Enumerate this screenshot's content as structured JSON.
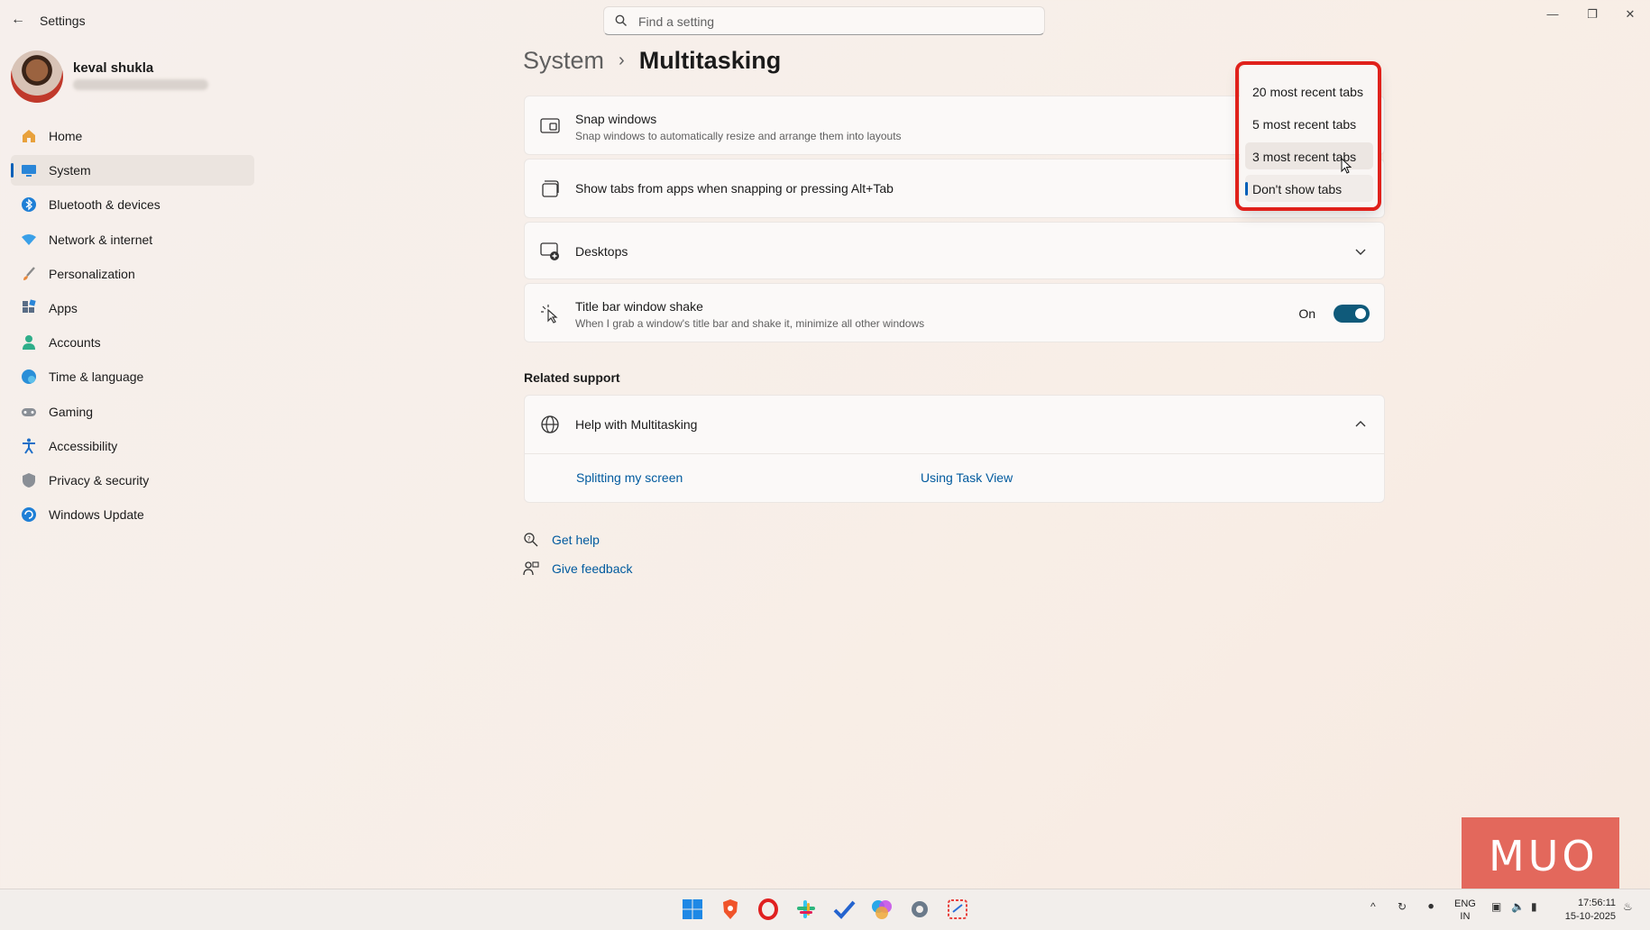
{
  "app": {
    "title": "Settings"
  },
  "search": {
    "placeholder": "Find a setting"
  },
  "user": {
    "name": "keval shukla"
  },
  "sidebar": {
    "items": [
      {
        "label": "Home",
        "icon": "home-icon"
      },
      {
        "label": "System",
        "icon": "system-icon",
        "active": true
      },
      {
        "label": "Bluetooth & devices",
        "icon": "bluetooth-icon"
      },
      {
        "label": "Network & internet",
        "icon": "network-icon"
      },
      {
        "label": "Personalization",
        "icon": "brush-icon"
      },
      {
        "label": "Apps",
        "icon": "apps-icon"
      },
      {
        "label": "Accounts",
        "icon": "accounts-icon"
      },
      {
        "label": "Time & language",
        "icon": "globe-clock-icon"
      },
      {
        "label": "Gaming",
        "icon": "gamepad-icon"
      },
      {
        "label": "Accessibility",
        "icon": "accessibility-icon"
      },
      {
        "label": "Privacy & security",
        "icon": "shield-icon"
      },
      {
        "label": "Windows Update",
        "icon": "update-icon"
      }
    ]
  },
  "breadcrumb": {
    "parent": "System",
    "separator": "›",
    "current": "Multitasking"
  },
  "settings": {
    "snap": {
      "title": "Snap windows",
      "desc": "Snap windows to automatically resize and arrange them into layouts"
    },
    "tabs": {
      "title": "Show tabs from apps when snapping or pressing Alt+Tab"
    },
    "desktops": {
      "title": "Desktops"
    },
    "shake": {
      "title": "Title bar window shake",
      "desc": "When I grab a window's title bar and shake it, minimize all other windows",
      "state": "On"
    }
  },
  "related": {
    "heading": "Related support",
    "help_title": "Help with Multitasking",
    "links": [
      "Splitting my screen",
      "Using Task View"
    ]
  },
  "footer_links": {
    "get_help": "Get help",
    "feedback": "Give feedback"
  },
  "dropdown": {
    "options": [
      "20 most recent tabs",
      "5 most recent tabs",
      "3 most recent tabs",
      "Don't show tabs"
    ],
    "selected": "Don't show tabs",
    "hovered": "3 most recent tabs"
  },
  "tray": {
    "lang_top": "ENG",
    "lang_bottom": "IN",
    "time": "17:56:11",
    "date": "15-10-2025"
  },
  "watermark": "MUO",
  "colors": {
    "accent": "#005fb8",
    "toggle_on": "#0f5a7a",
    "highlight_outline": "#e0211b",
    "link": "#005a9e"
  }
}
